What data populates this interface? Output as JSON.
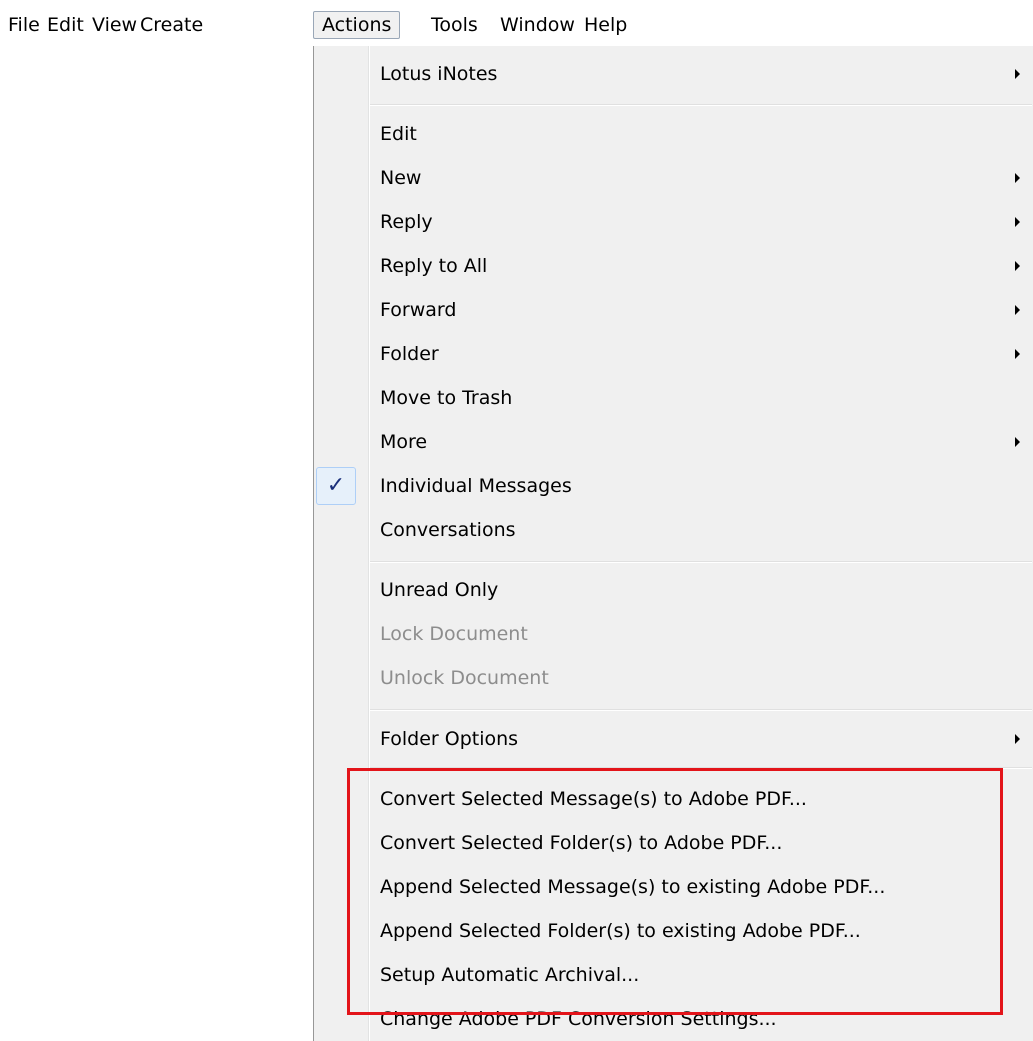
{
  "menubar": {
    "items": [
      {
        "label": "File"
      },
      {
        "label": "Edit"
      },
      {
        "label": "View"
      },
      {
        "label": "Create"
      },
      {
        "label": "Actions"
      },
      {
        "label": "Tools"
      },
      {
        "label": "Window"
      },
      {
        "label": "Help"
      }
    ],
    "active": "Actions"
  },
  "actions_menu": {
    "items": [
      {
        "label": "Lotus iNotes",
        "submenu": true
      },
      {
        "label": "Edit"
      },
      {
        "label": "New",
        "submenu": true
      },
      {
        "label": "Reply",
        "submenu": true
      },
      {
        "label": "Reply to All",
        "submenu": true
      },
      {
        "label": "Forward",
        "submenu": true
      },
      {
        "label": "Folder",
        "submenu": true
      },
      {
        "label": "Move to Trash"
      },
      {
        "label": "More",
        "submenu": true
      },
      {
        "label": "Individual Messages",
        "checked": true
      },
      {
        "label": "Conversations"
      },
      {
        "label": "Unread Only"
      },
      {
        "label": "Lock Document",
        "disabled": true
      },
      {
        "label": "Unlock Document",
        "disabled": true
      },
      {
        "label": "Folder Options",
        "submenu": true
      },
      {
        "label": "Convert Selected Message(s) to Adobe PDF..."
      },
      {
        "label": "Convert Selected Folder(s) to Adobe PDF..."
      },
      {
        "label": "Append Selected Message(s) to existing Adobe PDF..."
      },
      {
        "label": "Append Selected Folder(s) to existing Adobe PDF..."
      },
      {
        "label": "Setup Automatic Archival..."
      },
      {
        "label": "Change Adobe PDF Conversion Settings..."
      }
    ],
    "checkmark_glyph": "✓"
  },
  "colors": {
    "menu_background": "#f0f0f0",
    "disabled_text": "#8d8d8d",
    "highlight_box": "#e3141a",
    "checkmark": "#1a2f7a"
  },
  "icons": {
    "submenu": "chevron-right-icon",
    "checked": "checkmark-icon"
  }
}
